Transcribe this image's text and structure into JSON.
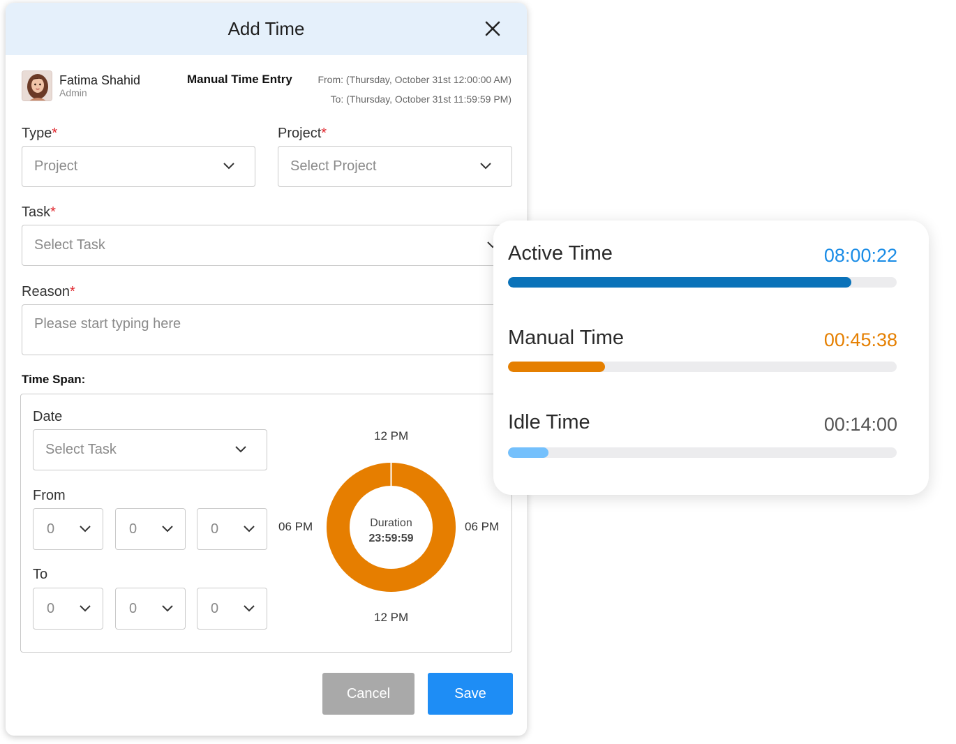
{
  "modal": {
    "title": "Add Time",
    "user": {
      "name": "Fatima Shahid",
      "role": "Admin"
    },
    "entry": {
      "title": "Manual Time Entry",
      "from": "From:  (Thursday, October 31st 12:00:00 AM)",
      "to": "To: (Thursday, October 31st 11:59:59 PM)"
    },
    "form": {
      "required_mark": "*",
      "type": {
        "label": "Type",
        "value": "Project"
      },
      "project": {
        "label": "Project",
        "placeholder": "Select Project"
      },
      "task": {
        "label": "Task",
        "placeholder": "Select Task"
      },
      "reason": {
        "label": "Reason",
        "placeholder": "Please start typing here"
      }
    },
    "time_span": {
      "label": "Time Span:",
      "date": {
        "label": "Date",
        "placeholder": "Select Task"
      },
      "from": {
        "label": "From",
        "values": [
          "0",
          "0",
          "0"
        ]
      },
      "to": {
        "label": "To",
        "values": [
          "0",
          "0",
          "0"
        ]
      },
      "clock": {
        "top": "12 PM",
        "bottom": "12 PM",
        "left": "06 PM",
        "right": "06 PM",
        "duration_label": "Duration",
        "duration_value": "23:59:59",
        "fill_fraction": 0.9999,
        "color": "#e67e00"
      }
    },
    "buttons": {
      "cancel": "Cancel",
      "save": "Save"
    }
  },
  "stats": [
    {
      "label": "Active Time",
      "value": "08:00:22",
      "color": "#1a8ce6",
      "bar_color": "#0a72b9",
      "fraction": 0.883
    },
    {
      "label": "Manual Time",
      "value": "00:45:38",
      "color": "#e57f00",
      "bar_color": "#e57f00",
      "fraction": 0.25
    },
    {
      "label": "Idle Time",
      "value": "00:14:00",
      "color": "#555555",
      "bar_color": "#74c0fc",
      "fraction": 0.105
    }
  ]
}
